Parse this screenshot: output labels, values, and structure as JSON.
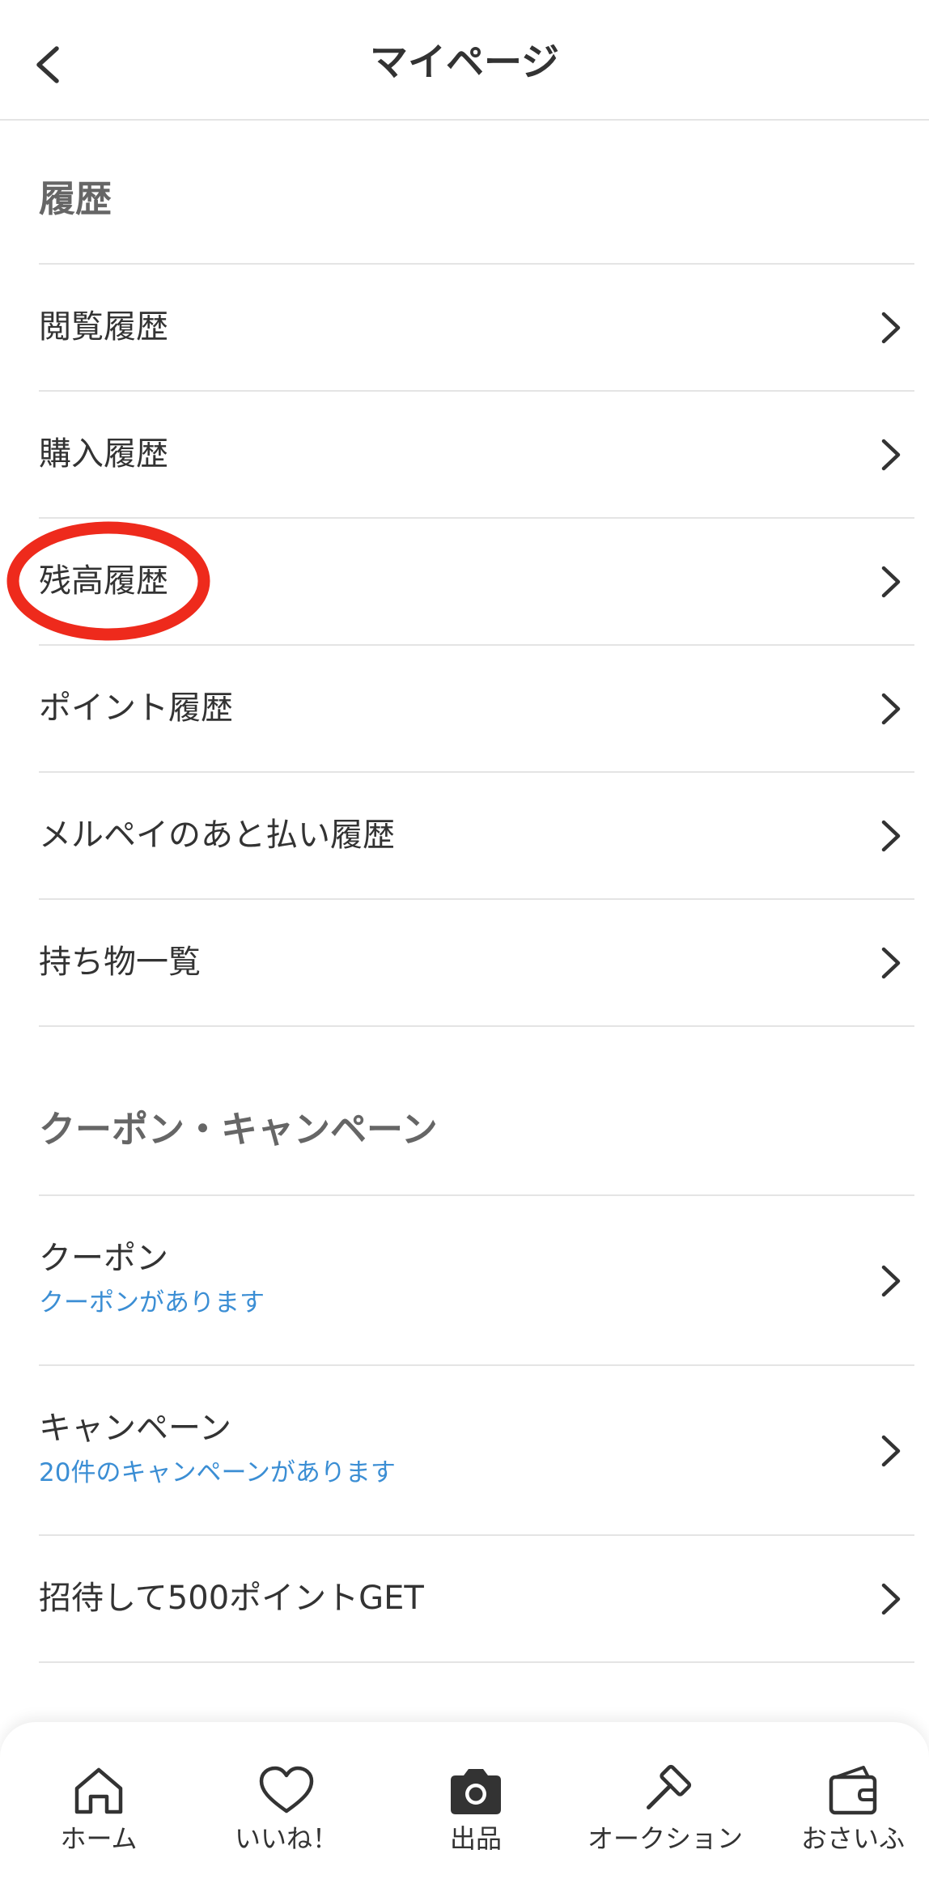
{
  "header": {
    "title": "マイページ"
  },
  "sections": {
    "history": {
      "title": "履歴",
      "items": [
        {
          "label": "閲覧履歴"
        },
        {
          "label": "購入履歴"
        },
        {
          "label": "残高履歴"
        },
        {
          "label": "ポイント履歴"
        },
        {
          "label": "メルペイのあと払い履歴"
        },
        {
          "label": "持ち物一覧"
        }
      ]
    },
    "coupons": {
      "title": "クーポン・キャンペーン",
      "items": [
        {
          "label": "クーポン",
          "sub": "クーポンがあります"
        },
        {
          "label": "キャンペーン",
          "sub": "20件のキャンペーンがあります"
        },
        {
          "label": "招待して500ポイントGET"
        }
      ]
    }
  },
  "tabbar": {
    "items": [
      {
        "label": "ホーム",
        "icon": "home-icon"
      },
      {
        "label": "いいね！",
        "icon": "heart-icon"
      },
      {
        "label": "出品",
        "icon": "camera-icon"
      },
      {
        "label": "オークション",
        "icon": "gavel-icon"
      },
      {
        "label": "おさいふ",
        "icon": "wallet-icon"
      }
    ]
  },
  "colors": {
    "accent_blue": "#3b8ed4",
    "highlight_red": "#ee2a1c",
    "divider": "#e4e4e4"
  }
}
